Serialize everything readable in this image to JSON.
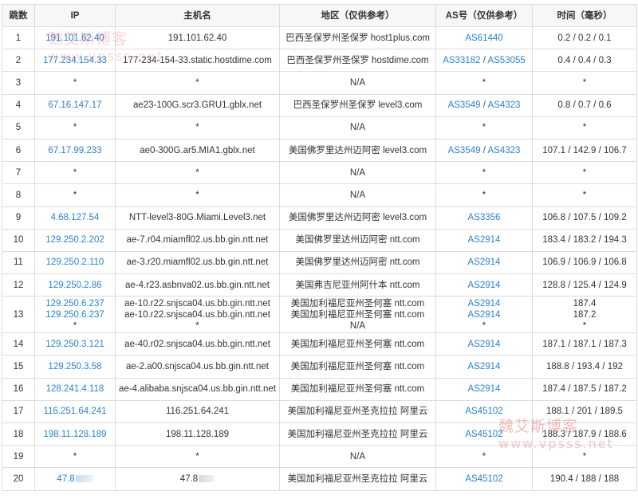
{
  "header": {
    "hop": "跳数",
    "ip": "IP",
    "host": "主机名",
    "region": "地区（仅供参考）",
    "asn": "AS号（仅供参考）",
    "time": "时间（毫秒）"
  },
  "rows": [
    {
      "hop": "1",
      "ip": "191.101.62.40",
      "host": "191.101.62.40",
      "region": "巴西圣保罗州圣保罗 host1plus.com",
      "as1": "AS61440",
      "as2": "",
      "time": "0.2 / 0.2 / 0.1"
    },
    {
      "hop": "2",
      "ip": "177.234.154.33",
      "host": "177-234-154-33.static.hostdime.com",
      "region": "巴西圣保罗州圣保罗 hostdime.com",
      "as1": "AS33182",
      "as2": "AS53055",
      "time": "0.4 / 0.4 / 0.3"
    },
    {
      "hop": "3",
      "ip": "*",
      "host": "*",
      "region": "N/A",
      "as1": "*",
      "as2": "",
      "time": "*"
    },
    {
      "hop": "4",
      "ip": "67.16.147.17",
      "host": "ae23-100G.scr3.GRU1.gblx.net",
      "region": "巴西圣保罗州圣保罗 level3.com",
      "as1": "AS3549",
      "as2": "AS4323",
      "time": "0.8 / 0.7 / 0.6"
    },
    {
      "hop": "5",
      "ip": "*",
      "host": "*",
      "region": "N/A",
      "as1": "*",
      "as2": "",
      "time": "*"
    },
    {
      "hop": "6",
      "ip": "67.17.99.233",
      "host": "ae0-300G.ar5.MIA1.gblx.net",
      "region": "美国佛罗里达州迈阿密 level3.com",
      "as1": "AS3549",
      "as2": "AS4323",
      "time": "107.1 / 142.9 / 106.7"
    },
    {
      "hop": "7",
      "ip": "*",
      "host": "*",
      "region": "N/A",
      "as1": "*",
      "as2": "",
      "time": "*"
    },
    {
      "hop": "8",
      "ip": "*",
      "host": "*",
      "region": "N/A",
      "as1": "*",
      "as2": "",
      "time": "*"
    },
    {
      "hop": "9",
      "ip": "4.68.127.54",
      "host": "NTT-level3-80G.Miami.Level3.net",
      "region": "美国佛罗里达州迈阿密 level3.com",
      "as1": "AS3356",
      "as2": "",
      "time": "106.8 / 107.5 / 109.2"
    },
    {
      "hop": "10",
      "ip": "129.250.2.202",
      "host": "ae-7.r04.miamfl02.us.bb.gin.ntt.net",
      "region": "美国佛罗里达州迈阿密 ntt.com",
      "as1": "AS2914",
      "as2": "",
      "time": "183.4 / 183.2 / 194.3"
    },
    {
      "hop": "11",
      "ip": "129.250.2.110",
      "host": "ae-3.r20.miamfl02.us.bb.gin.ntt.net",
      "region": "美国佛罗里达州迈阿密 ntt.com",
      "as1": "AS2914",
      "as2": "",
      "time": "106.9 / 106.9 / 106.8"
    },
    {
      "hop": "12",
      "ip": "129.250.2.86",
      "host": "ae-4.r23.asbnva02.us.bb.gin.ntt.net",
      "region": "美国弗吉尼亚州阿什本 ntt.com",
      "as1": "AS2914",
      "as2": "",
      "time": "128.8 / 125.4 / 124.9"
    }
  ],
  "row13": {
    "hop": "13",
    "ip": [
      "129.250.6.237",
      "129.250.6.237",
      "*"
    ],
    "host": [
      "ae-10.r22.snjsca04.us.bb.gin.ntt.net",
      "ae-10.r22.snjsca04.us.bb.gin.ntt.net",
      "*"
    ],
    "region": [
      "美国加利福尼亚州圣何塞 ntt.com",
      "美国加利福尼亚州圣何塞 ntt.com",
      "N/A"
    ],
    "asn": [
      "AS2914",
      "AS2914",
      "*"
    ],
    "time": [
      "187.4",
      "187.2",
      "*"
    ]
  },
  "rows2": [
    {
      "hop": "14",
      "ip": "129.250.3.121",
      "host": "ae-40.r02.snjsca04.us.bb.gin.ntt.net",
      "region": "美国加利福尼亚州圣何塞 ntt.com",
      "as1": "AS2914",
      "as2": "",
      "time": "187.1 / 187.1 / 187.3"
    },
    {
      "hop": "15",
      "ip": "129.250.3.58",
      "host": "ae-2.a00.snjsca04.us.bb.gin.ntt.net",
      "region": "美国加利福尼亚州圣何塞 ntt.com",
      "as1": "AS2914",
      "as2": "",
      "time": "188.8 / 193.4 / 192"
    },
    {
      "hop": "16",
      "ip": "128.241.4.118",
      "host": "ae-4.alibaba.snjsca04.us.bb.gin.ntt.net",
      "region": "美国加利福尼亚州圣何塞 ntt.com",
      "as1": "AS2914",
      "as2": "",
      "time": "187.4 / 187.5 / 187.2"
    },
    {
      "hop": "17",
      "ip": "116.251.64.241",
      "host": "116.251.64.241",
      "region": "美国加利福尼亚州圣克拉拉 阿里云",
      "as1": "AS45102",
      "as2": "",
      "time": "188.1 / 201 / 189.5"
    },
    {
      "hop": "18",
      "ip": "198.11.128.189",
      "host": "198.11.128.189",
      "region": "美国加利福尼亚州圣克拉拉 阿里云",
      "as1": "AS45102",
      "as2": "",
      "time": "188.3 / 187.9 / 188.6"
    },
    {
      "hop": "19",
      "ip": "*",
      "host": "*",
      "region": "N/A",
      "as1": "*",
      "as2": "",
      "time": "*"
    },
    {
      "hop": "20",
      "ip": "47.8",
      "host": "47.8",
      "region": "美国加利福尼亚州圣克拉拉 阿里云",
      "as1": "AS45102",
      "as2": "",
      "time": "190.4 / 188 / 188"
    }
  ],
  "watermark": {
    "brand": "魏艾斯博客",
    "site": "www.vpsss.net"
  },
  "colors": {
    "link": "#2b82d0",
    "header_bg": "#f7f7f7",
    "border": "#dcdcdc"
  }
}
